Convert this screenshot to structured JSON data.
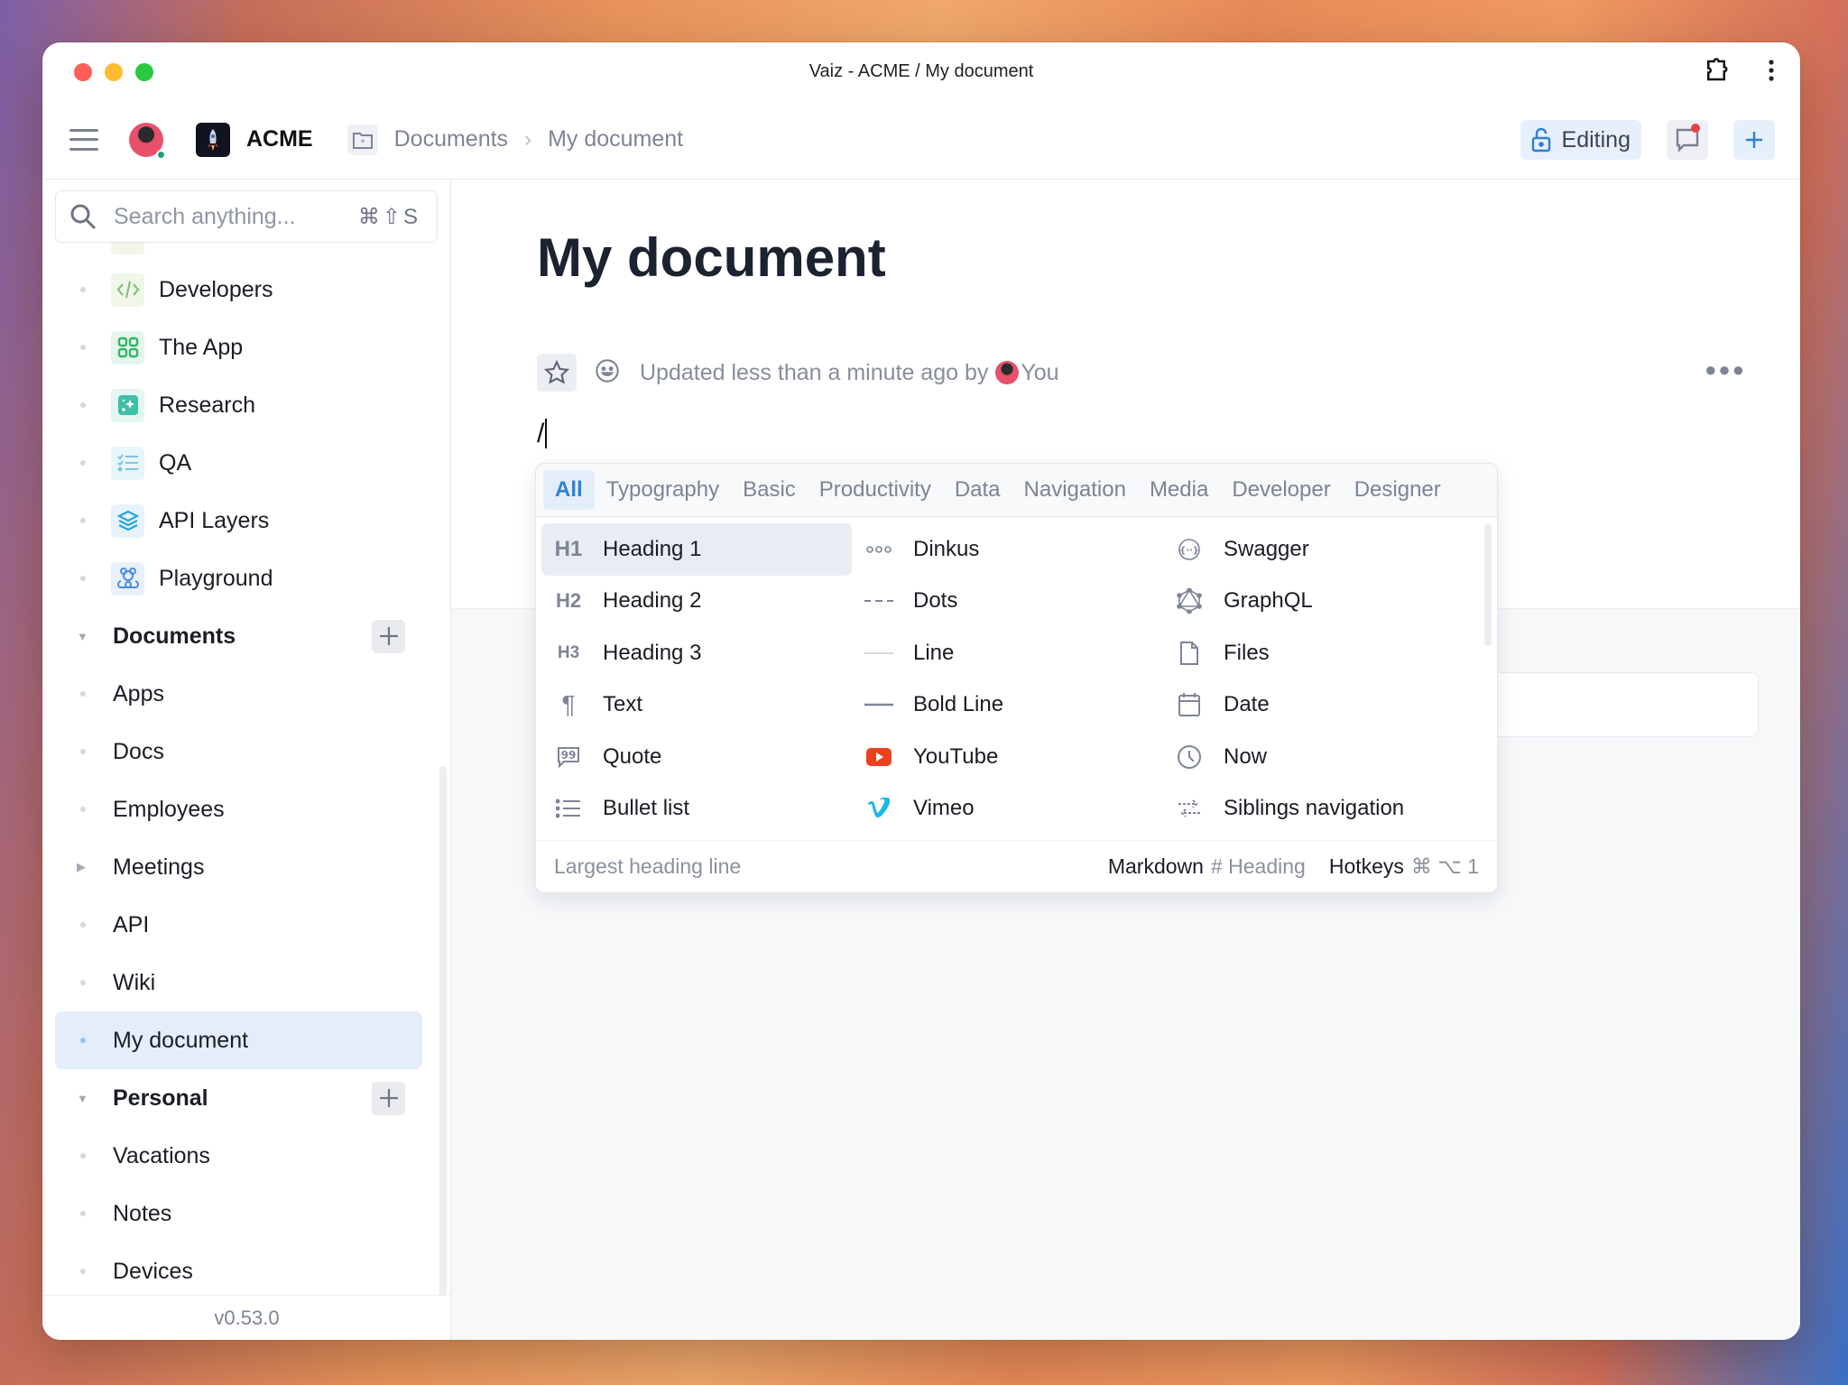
{
  "window": {
    "title": "Vaiz - ACME / My document"
  },
  "header": {
    "workspace_name": "ACME",
    "breadcrumb": [
      "Documents",
      "My document"
    ],
    "editing_label": "Editing"
  },
  "sidebar": {
    "search_placeholder": "Search anything...",
    "search_shortcut": "⌘⇧S",
    "items": [
      {
        "label": "Developers",
        "icon": "code-icon",
        "type": "space"
      },
      {
        "label": "The App",
        "icon": "grid-icon",
        "type": "space"
      },
      {
        "label": "Research",
        "icon": "sparkle-icon",
        "type": "space"
      },
      {
        "label": "QA",
        "icon": "checklist-icon",
        "type": "space"
      },
      {
        "label": "API Layers",
        "icon": "layers-icon",
        "type": "space"
      },
      {
        "label": "Playground",
        "icon": "teddy-bear-icon",
        "type": "space"
      }
    ],
    "sections": [
      {
        "label": "Documents",
        "items": [
          "Apps",
          "Docs",
          "Employees",
          "Meetings",
          "API",
          "Wiki",
          "My document"
        ],
        "collapsed_children": [
          "Meetings"
        ],
        "active": "My document"
      },
      {
        "label": "Personal",
        "items": [
          "Vacations",
          "Notes",
          "Devices"
        ]
      }
    ],
    "version": "v0.53.0"
  },
  "document": {
    "title": "My document",
    "meta_text": "Updated less than a minute ago by",
    "meta_user": "You",
    "editor_input": "/"
  },
  "slash_menu": {
    "tabs": [
      "All",
      "Typography",
      "Basic",
      "Productivity",
      "Data",
      "Navigation",
      "Media",
      "Developer",
      "Designer"
    ],
    "active_tab": "All",
    "columns": [
      [
        {
          "label": "Heading 1",
          "icon": "H1",
          "icon_name": "heading-1-icon"
        },
        {
          "label": "Heading 2",
          "icon": "H2",
          "icon_name": "heading-2-icon"
        },
        {
          "label": "Heading 3",
          "icon": "H3",
          "icon_name": "heading-3-icon"
        },
        {
          "label": "Text",
          "icon": "¶",
          "icon_name": "paragraph-icon"
        },
        {
          "label": "Quote",
          "icon": "quote",
          "icon_name": "quote-icon"
        },
        {
          "label": "Bullet list",
          "icon": "list",
          "icon_name": "bullet-list-icon"
        }
      ],
      [
        {
          "label": "Dinkus",
          "icon": "ooo",
          "icon_name": "dinkus-icon"
        },
        {
          "label": "Dots",
          "icon": "---",
          "icon_name": "dots-icon"
        },
        {
          "label": "Line",
          "icon": "line",
          "icon_name": "line-icon"
        },
        {
          "label": "Bold Line",
          "icon": "boldline",
          "icon_name": "bold-line-icon"
        },
        {
          "label": "YouTube",
          "icon": "youtube",
          "icon_name": "youtube-icon"
        },
        {
          "label": "Vimeo",
          "icon": "vimeo",
          "icon_name": "vimeo-icon"
        }
      ],
      [
        {
          "label": "Swagger",
          "icon": "swagger",
          "icon_name": "swagger-icon"
        },
        {
          "label": "GraphQL",
          "icon": "graphql",
          "icon_name": "graphql-icon"
        },
        {
          "label": "Files",
          "icon": "file",
          "icon_name": "file-icon"
        },
        {
          "label": "Date",
          "icon": "calendar",
          "icon_name": "calendar-icon"
        },
        {
          "label": "Now",
          "icon": "clock",
          "icon_name": "clock-icon"
        },
        {
          "label": "Siblings navigation",
          "icon": "arrows",
          "icon_name": "siblings-arrows-icon"
        }
      ]
    ],
    "selected": "Heading 1",
    "footer": {
      "description": "Largest heading line",
      "markdown_label": "Markdown",
      "markdown_value": "# Heading",
      "hotkeys_label": "Hotkeys",
      "hotkeys_value": "⌘ ⌥ 1"
    }
  },
  "colors": {
    "accent": "#2f7fd8",
    "active_bg": "#e3eefa",
    "youtube": "#e9421e",
    "vimeo": "#1ab7ea",
    "notification": "#e8424a"
  }
}
